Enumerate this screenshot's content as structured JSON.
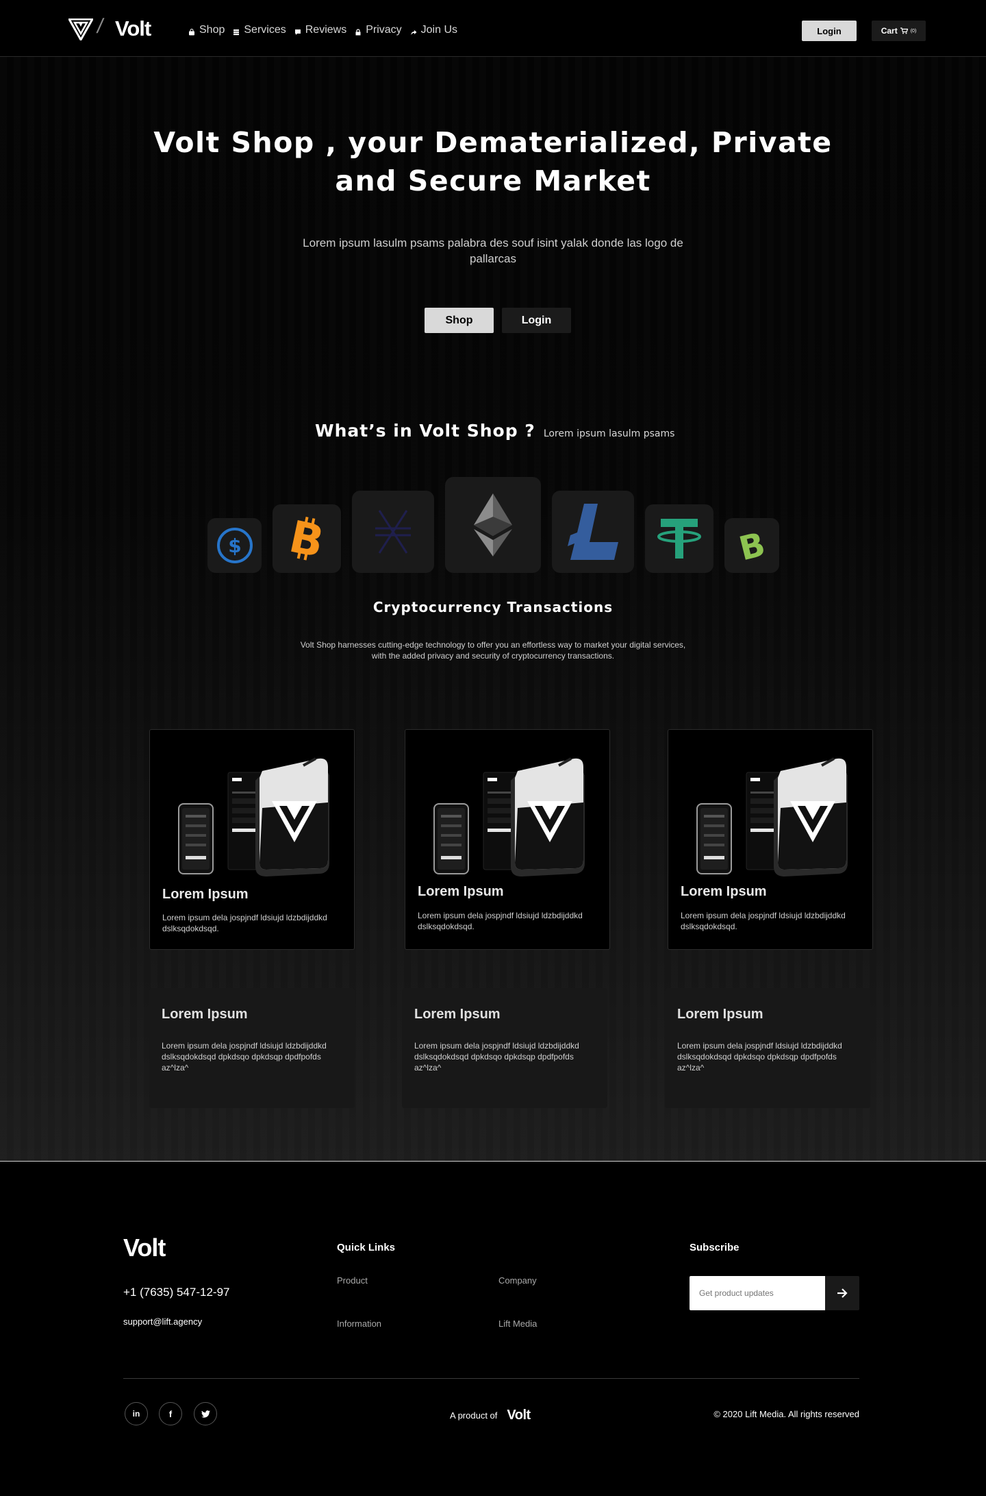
{
  "nav": {
    "brand": "Volt",
    "items": [
      {
        "label": "Shop",
        "icon": "bag-icon"
      },
      {
        "label": "Services",
        "icon": "stack-icon"
      },
      {
        "label": "Reviews",
        "icon": "chat-icon"
      },
      {
        "label": "Privacy",
        "icon": "lock-icon"
      },
      {
        "label": "Join Us",
        "icon": "share-arrow-icon"
      }
    ],
    "login_label": "Login",
    "cart_label": "Cart",
    "cart_count": "(0)"
  },
  "hero": {
    "title": "Volt Shop , your Dematerialized, Private and Secure Market",
    "subtitle": "Lorem ipsum lasulm psams palabra des souf isint yalak donde las logo de pallarcas",
    "shop_label": "Shop",
    "login_label": "Login"
  },
  "features": {
    "title": "What’s in Volt Shop ?",
    "subtitle": "Lorem ipsum lasulm psams",
    "coins": [
      {
        "name": "usdc-icon",
        "color": "#2775ca"
      },
      {
        "name": "bitcoin-icon",
        "color": "#f7931a"
      },
      {
        "name": "stellar-icon",
        "color": "#1f1f4d"
      },
      {
        "name": "ethereum-icon",
        "color": "#8c8c8c"
      },
      {
        "name": "litecoin-icon",
        "color": "#345d9d"
      },
      {
        "name": "tether-icon",
        "color": "#26a17b"
      },
      {
        "name": "bitcoin-cash-icon",
        "color": "#8dc351"
      }
    ],
    "crypto_title": "Cryptocurrency Transactions",
    "crypto_desc": "Volt Shop harnesses cutting-edge technology to offer you an effortless way to market your digital services, with the added privacy and security of cryptocurrency transactions."
  },
  "cards": [
    {
      "title": "Lorem Ipsum",
      "text": "Lorem ipsum dela jospjndf ldsiujd ldzbdijddkd dslksqdokdsqd."
    },
    {
      "title": "Lorem Ipsum",
      "text": "Lorem ipsum dela jospjndf ldsiujd ldzbdijddkd dslksqdokdsqd."
    },
    {
      "title": "Lorem Ipsum",
      "text": "Lorem ipsum dela jospjndf ldsiujd ldzbdijddkd dslksqdokdsqd."
    }
  ],
  "text_cards": [
    {
      "title": "Lorem Ipsum",
      "text": "Lorem ipsum dela jospjndf ldsiujd ldzbdijddkd dslksqdokdsqd  dpkdsqo dpkdsqp dpdfpofds az^lza^"
    },
    {
      "title": "Lorem Ipsum",
      "text": "Lorem ipsum dela jospjndf ldsiujd ldzbdijddkd dslksqdokdsqd  dpkdsqo dpkdsqp dpdfpofds az^lza^"
    },
    {
      "title": "Lorem Ipsum",
      "text": "Lorem ipsum dela jospjndf ldsiujd ldzbdijddkd dslksqdokdsqd  dpkdsqo dpkdsqp dpdfpofds az^lza^"
    }
  ],
  "footer": {
    "brand": "Volt",
    "phone": "+1 (7635) 547-12-97",
    "email": "support@lift.agency",
    "quick_links_title": "Quick Links",
    "links": [
      "Product",
      "Company",
      "Information",
      "Lift Media"
    ],
    "subscribe_title": "Subscribe",
    "subscribe_placeholder": "Get product updates",
    "product_of": "A product of",
    "product_brand": "Volt",
    "copyright": "© 2020 Lift Media. All rights reserved",
    "socials": [
      "linkedin-icon",
      "facebook-icon",
      "twitter-icon"
    ]
  }
}
